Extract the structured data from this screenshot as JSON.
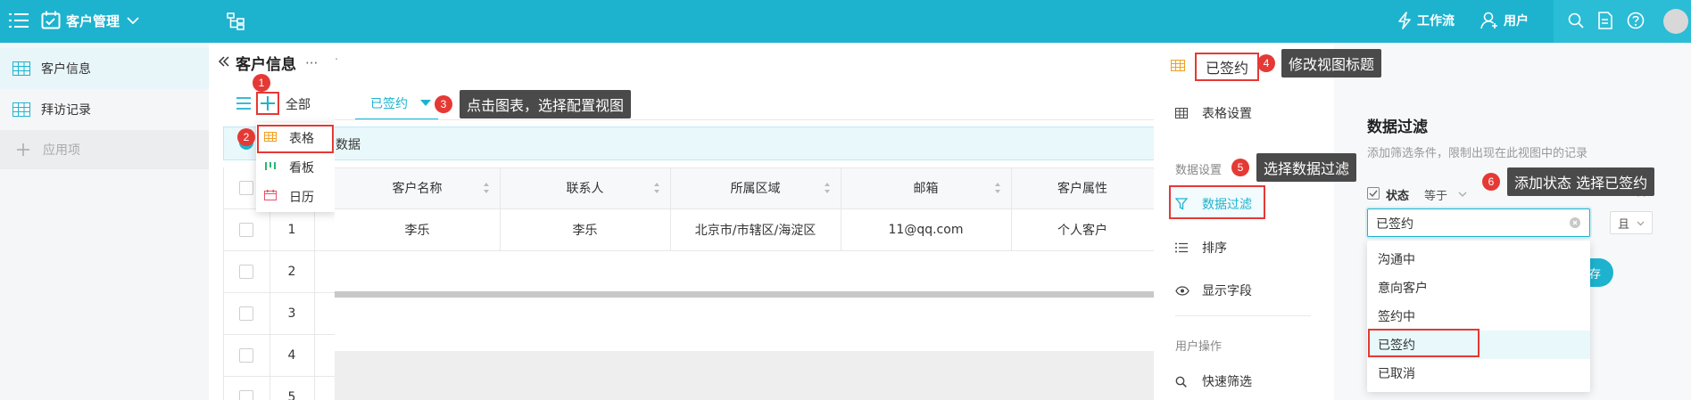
{
  "topbar": {
    "app_title": "客户管理",
    "workflow_label": "工作流",
    "user_label": "用户"
  },
  "sidebar": {
    "items": [
      {
        "label": "客户信息"
      },
      {
        "label": "拜访记录"
      },
      {
        "label": "应用项"
      }
    ]
  },
  "page": {
    "title": "客户信息",
    "more": "···",
    "all_label": "全部",
    "view_tab": "已签约",
    "notice_text": "数据"
  },
  "view_type_menu": {
    "items": [
      {
        "label": "表格"
      },
      {
        "label": "看板"
      },
      {
        "label": "日历"
      }
    ]
  },
  "table": {
    "columns": [
      "客户名称",
      "联系人",
      "所属区域",
      "邮箱",
      "客户属性"
    ],
    "row_numbers": [
      "1",
      "2",
      "3",
      "4",
      "5"
    ],
    "rows": [
      [
        "李乐",
        "李乐",
        "北京市/市辖区/海淀区",
        "11@qq.com",
        "个人客户"
      ]
    ]
  },
  "right_panel": {
    "view_title": "已签约",
    "table_settings": "表格设置",
    "data_settings_header": "数据设置",
    "data_filter": "数据过滤",
    "sort": "排序",
    "display_fields": "显示字段",
    "user_ops_header": "用户操作",
    "quick_filter": "快速筛选"
  },
  "filter": {
    "title": "数据过滤",
    "description": "添加筛选条件，限制出现在此视图中的记录",
    "field_label": "状态",
    "operator": "等于",
    "value": "已签约",
    "logic": "且",
    "save_partial": "存",
    "options": [
      "沟通中",
      "意向客户",
      "签约中",
      "已签约",
      "已取消"
    ]
  },
  "annotations": [
    {
      "num": "1"
    },
    {
      "num": "2"
    },
    {
      "num": "3",
      "text": "点击图表，选择配置视图"
    },
    {
      "num": "4",
      "text": "修改视图标题"
    },
    {
      "num": "5",
      "text": "选择数据过滤"
    },
    {
      "num": "6",
      "text": "添加状态 选择已签约"
    }
  ],
  "colors": {
    "topbar": "#1db3cf",
    "accent": "#1db3cf",
    "annotation_red": "#e53935",
    "tooltip_bg": "#4a4a4a"
  }
}
